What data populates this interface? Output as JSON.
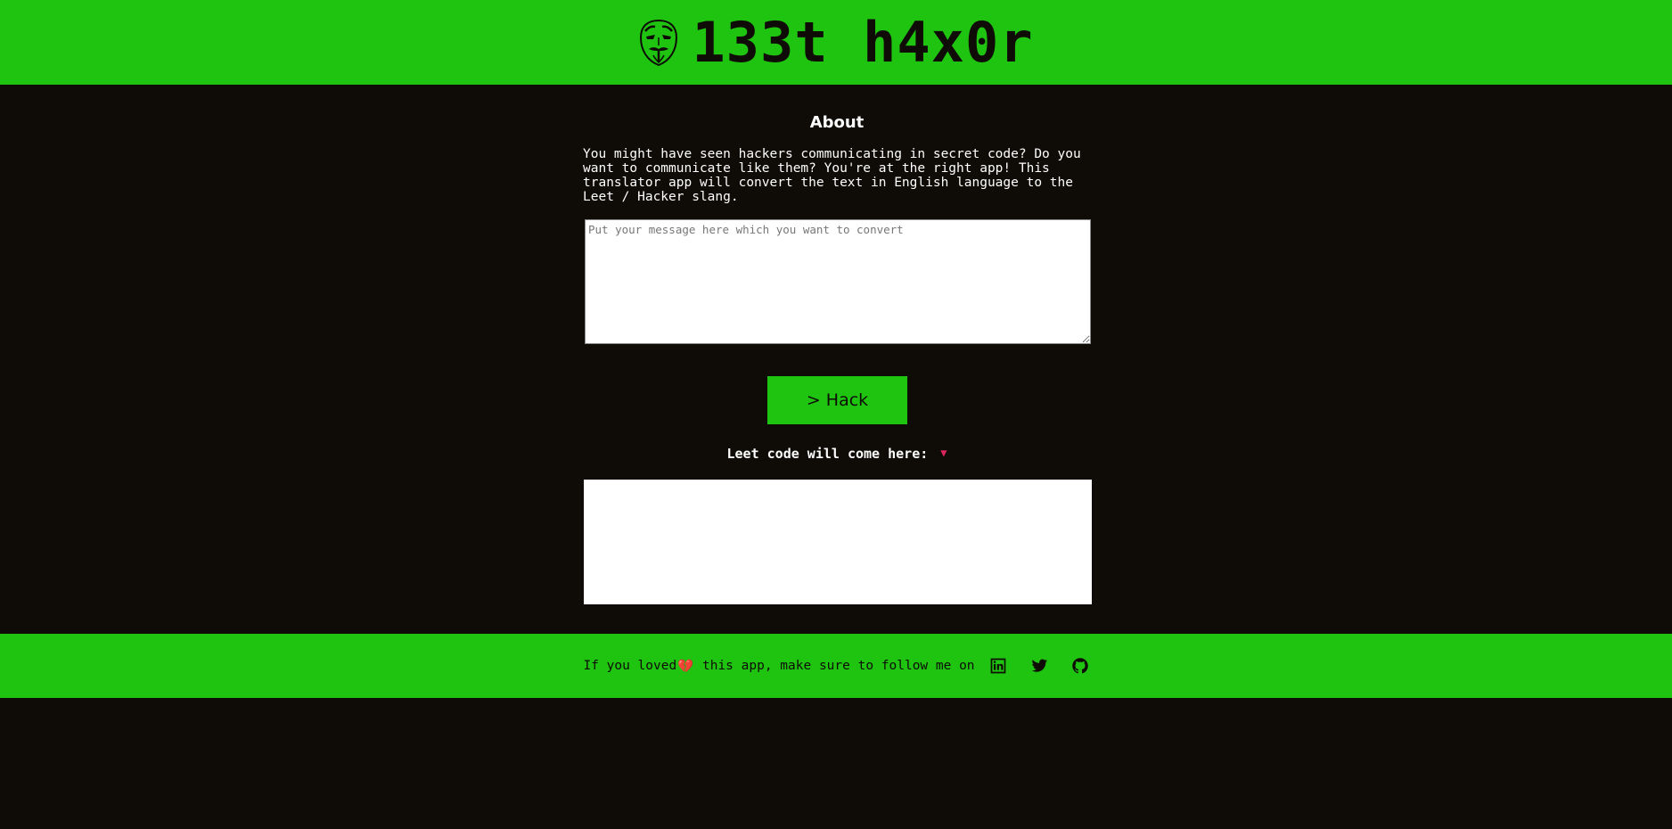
{
  "header": {
    "logo_icon": "anonymous-mask-icon",
    "title": "133t h4x0r"
  },
  "about": {
    "heading": "About",
    "text": "You might have seen hackers communicating in secret code? Do you want to communicate like them? You're at the right app! This translator app will convert the text in English language to the Leet / Hacker slang."
  },
  "input": {
    "value": "",
    "placeholder": "Put your message here which you want to convert"
  },
  "hack_button": {
    "label": "> Hack"
  },
  "output": {
    "label": "Leet code will come here:",
    "arrow": "▼",
    "value": ""
  },
  "footer": {
    "text_before": "If you loved",
    "heart": "💔",
    "text_after": " this app, make sure to follow me on",
    "social": [
      {
        "name": "linkedin-icon"
      },
      {
        "name": "twitter-icon"
      },
      {
        "name": "github-icon"
      }
    ]
  },
  "colors": {
    "accent": "#1ec40f",
    "background": "#0f0c08",
    "heart": "#e0245e"
  }
}
